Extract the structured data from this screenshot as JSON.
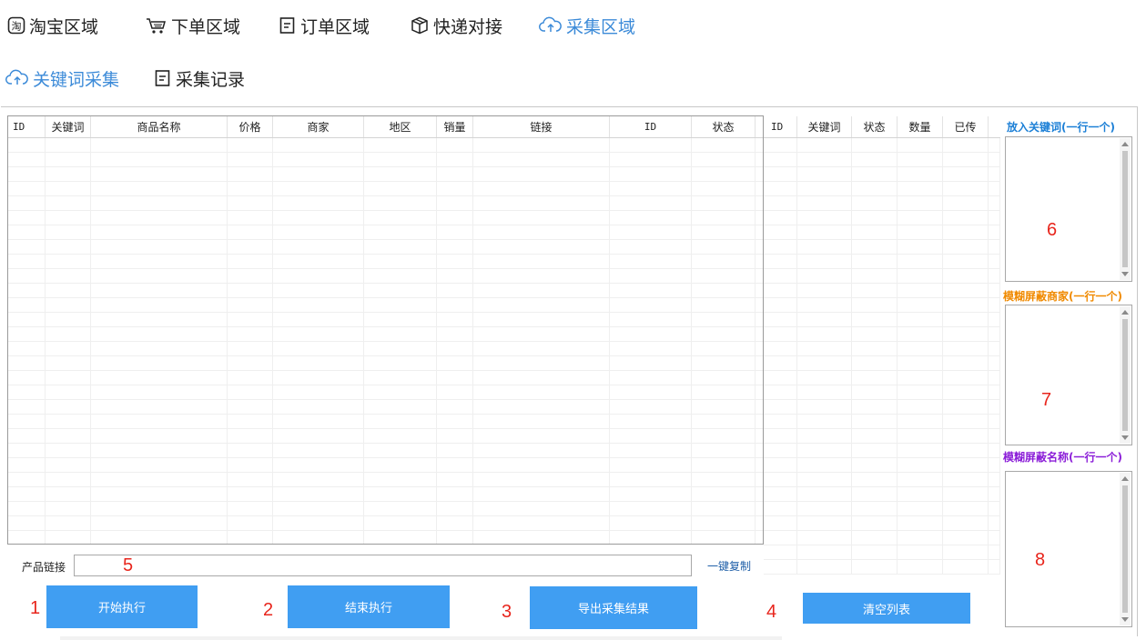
{
  "nav": {
    "items": [
      {
        "label": "淘宝区域",
        "icon": "taobao-icon"
      },
      {
        "label": "下单区域",
        "icon": "cart-icon"
      },
      {
        "label": "订单区域",
        "icon": "document-icon"
      },
      {
        "label": "快递对接",
        "icon": "box-icon"
      },
      {
        "label": "采集区域",
        "icon": "cloud-icon",
        "active": true
      }
    ]
  },
  "subnav": {
    "items": [
      {
        "label": "关键词采集",
        "icon": "cloud-icon",
        "active": true
      },
      {
        "label": "采集记录",
        "icon": "document-icon"
      }
    ]
  },
  "main_grid": {
    "columns": [
      "ID",
      "关键词",
      "商品名称",
      "价格",
      "商家",
      "地区",
      "销量",
      "链接",
      "ID",
      "状态"
    ],
    "rows": []
  },
  "keyword_grid": {
    "columns": [
      "ID",
      "关键词",
      "状态",
      "数量",
      "已传"
    ],
    "rows": []
  },
  "side": {
    "keywords_label": "放入关键词(一行一个)",
    "block_merchant_label": "模糊屏蔽商家(一行一个)",
    "block_name_label": "模糊屏蔽名称(一行一个)",
    "keywords_value": "",
    "block_merchant_value": "",
    "block_name_value": ""
  },
  "link_field": {
    "label": "产品链接",
    "value": "",
    "copy_label": "一键复制"
  },
  "buttons": {
    "start": "开始执行",
    "stop": "结束执行",
    "export": "导出采集结果",
    "clear": "清空列表"
  },
  "annotations": [
    "1",
    "2",
    "3",
    "4",
    "5",
    "6",
    "7",
    "8"
  ],
  "colors": {
    "accent": "#3b8ad8",
    "button": "#409ef2",
    "keywords_label": "#1b7fd6",
    "block_merchant_label": "#f08a00",
    "block_name_label": "#8b1ed8",
    "annotation": "#e8251c"
  }
}
